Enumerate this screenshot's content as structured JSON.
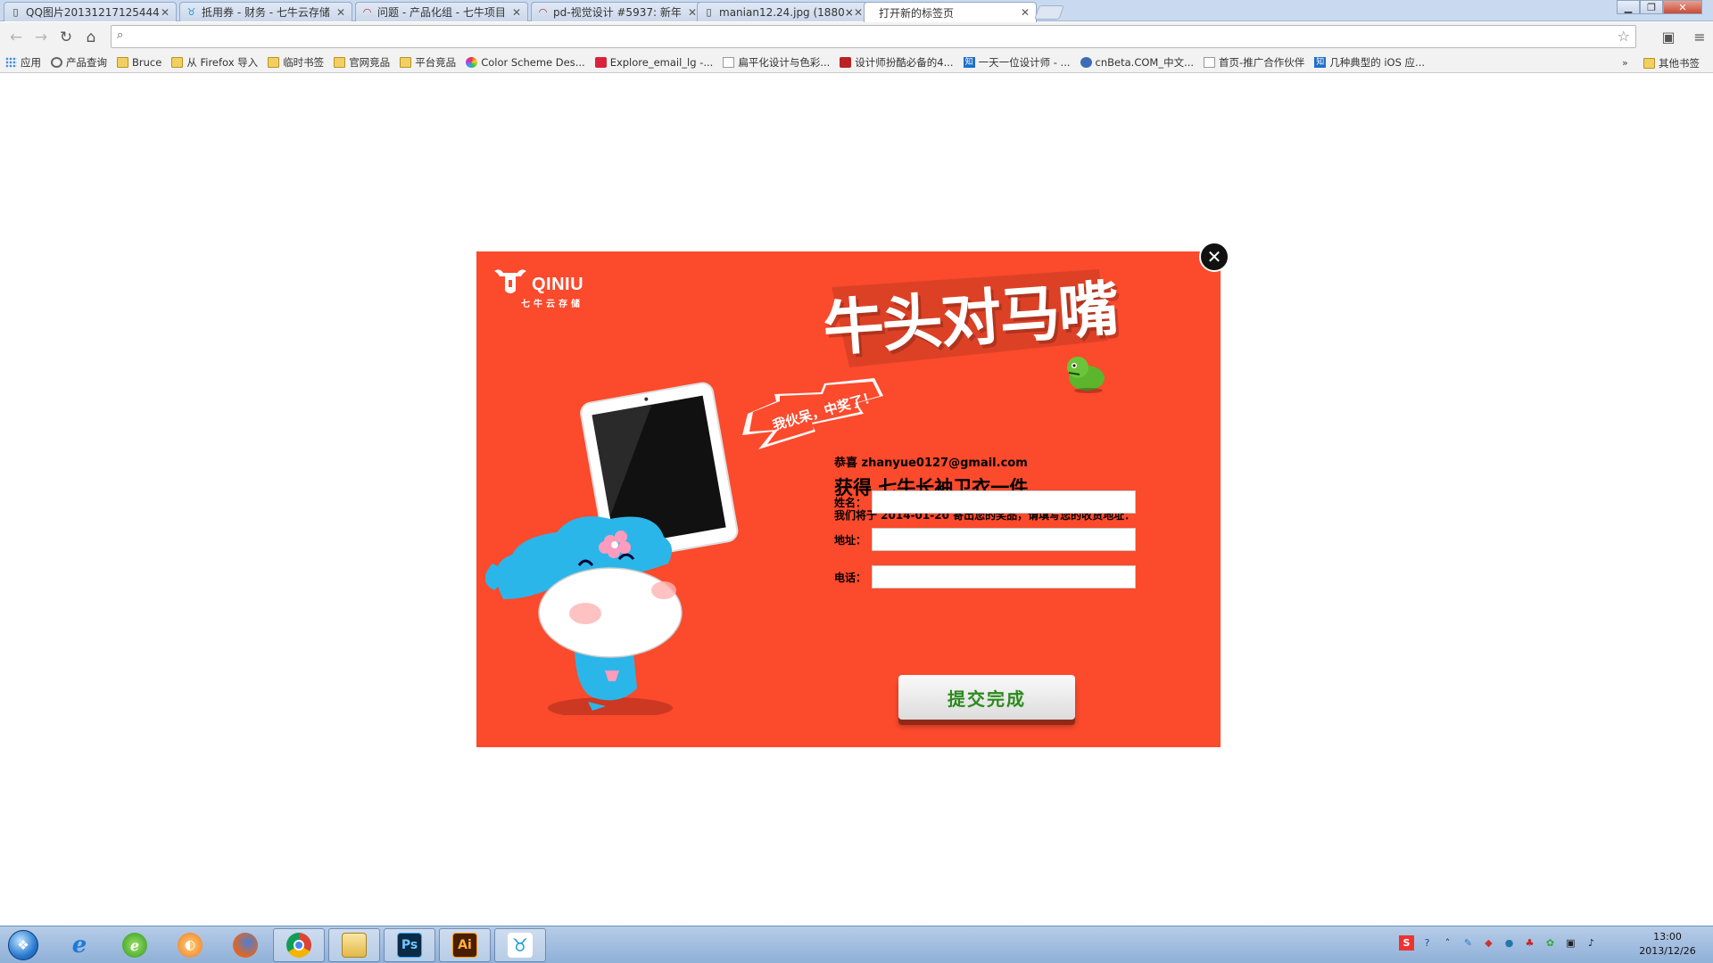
{
  "browser": {
    "tabs": [
      {
        "title": "QQ图片20131217125444",
        "active": false
      },
      {
        "title": "抵用券 - 财务 - 七牛云存储",
        "active": false
      },
      {
        "title": "问题 - 产品化组 - 七牛项目",
        "active": false
      },
      {
        "title": "pd-视觉设计 #5937: 新年",
        "active": false
      },
      {
        "title": "manian12.24.jpg (1880×",
        "active": false
      },
      {
        "title": "打开新的标签页",
        "active": true
      }
    ],
    "address": {
      "value": "",
      "placeholder": ""
    },
    "bookmarks": [
      {
        "label": "应用",
        "icon": "apps-icon"
      },
      {
        "label": "产品查询",
        "icon": "site-icon"
      },
      {
        "label": "Bruce",
        "icon": "folder-icon"
      },
      {
        "label": "从 Firefox 导入",
        "icon": "folder-icon"
      },
      {
        "label": "临时书签",
        "icon": "folder-icon"
      },
      {
        "label": "官网竞品",
        "icon": "folder-icon"
      },
      {
        "label": "平台竞品",
        "icon": "folder-icon"
      },
      {
        "label": "Color Scheme Des...",
        "icon": "colorwheel-icon"
      },
      {
        "label": "Explore_email_lg -...",
        "icon": "site-icon"
      },
      {
        "label": "扁平化设计与色彩...",
        "icon": "page-icon"
      },
      {
        "label": "设计师扮酷必备的4...",
        "icon": "site-icon"
      },
      {
        "label": "一天一位设计师 - ...",
        "icon": "zhihu-icon"
      },
      {
        "label": "cnBeta.COM_中文...",
        "icon": "site-icon"
      },
      {
        "label": "首页-推广合作伙伴",
        "icon": "page-icon"
      },
      {
        "label": "几种典型的 iOS 应...",
        "icon": "zhihu-icon"
      }
    ],
    "bookmarks_more": "»",
    "bookmarks_other": "其他书签"
  },
  "modal": {
    "logo_text": "QINIU",
    "logo_subtitle": "七牛云存储",
    "headline": "牛头对马嘴",
    "bubble": "我伙呆，中奖了！",
    "congrats": "恭喜 zhanyue0127@gmail.com",
    "prize": "获得 七牛长袖卫衣一件",
    "notice": "我们将于 2014-01-20 寄出您的奖品，请填写您的收货地址：",
    "fields": [
      {
        "label": "姓名：",
        "value": ""
      },
      {
        "label": "地址：",
        "value": ""
      },
      {
        "label": "电话：",
        "value": ""
      }
    ],
    "submit_label": "提交完成",
    "colors": {
      "background": "#fb4a2c",
      "button_text": "#2c8a1e"
    }
  },
  "taskbar": {
    "apps": [
      {
        "name": "internet-explorer-icon"
      },
      {
        "name": "green-browser-icon"
      },
      {
        "name": "media-player-icon"
      },
      {
        "name": "firefox-icon"
      },
      {
        "name": "chrome-icon"
      },
      {
        "name": "file-explorer-icon"
      },
      {
        "name": "photoshop-icon",
        "text": "Ps"
      },
      {
        "name": "illustrator-icon",
        "text": "Ai"
      },
      {
        "name": "qiniu-app-icon"
      }
    ],
    "clock": {
      "time": "13:00",
      "date": "2013/12/26"
    }
  }
}
